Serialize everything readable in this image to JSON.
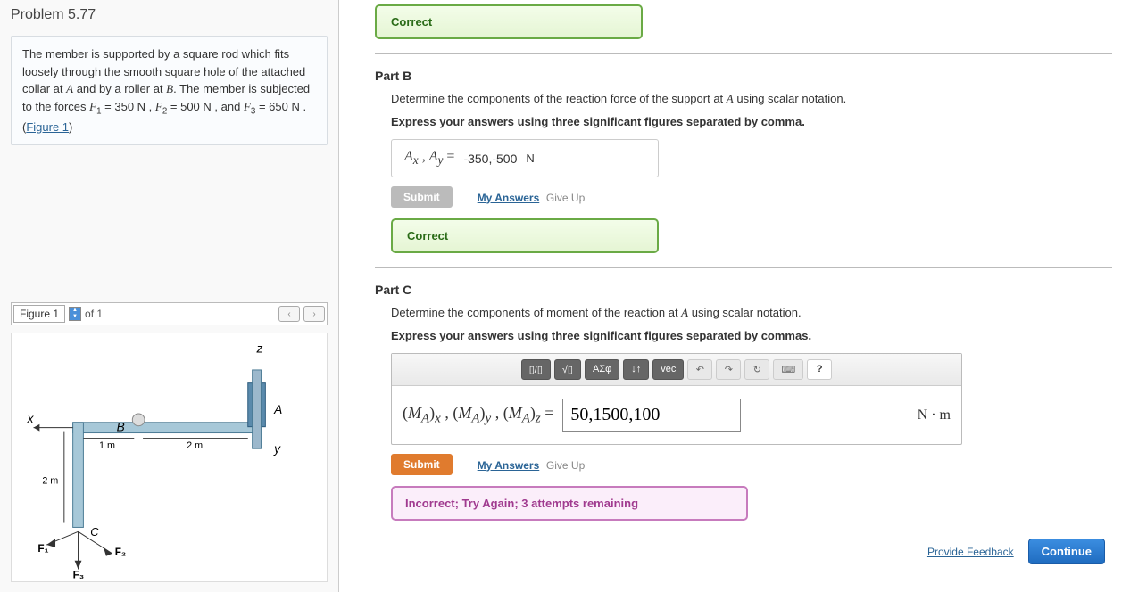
{
  "problem": {
    "title": "Problem 5.77",
    "text_pre": "The member is supported by a square rod which fits loosely through the smooth square hole of the attached collar at ",
    "A": "A",
    "text_mid1": " and by a roller at ",
    "B": "B",
    "text_mid2": ". The member is subjected to the forces ",
    "F1_lhs": "F",
    "F1_sub": "1",
    "F1_eq": " = 350  N , ",
    "F2_lhs": "F",
    "F2_sub": "2",
    "F2_eq": " = 500  N , and ",
    "F3_lhs": "F",
    "F3_sub": "3",
    "F3_eq": " = 650  N . (",
    "figure_link": "Figure 1",
    "text_end": ")"
  },
  "figure": {
    "label": "Figure 1",
    "count_of": "of 1",
    "prev": "‹",
    "next": "›",
    "axis_z": "z",
    "axis_x": "x",
    "axis_y": "y",
    "ptA": "A",
    "ptB": "B",
    "ptC": "C",
    "d1": "1 m",
    "d2a": "2 m",
    "d2b": "2 m",
    "F1": "F₁",
    "F2": "F₂",
    "F3": "F₃"
  },
  "partTop": {
    "correct": "Correct"
  },
  "partB": {
    "heading": "Part B",
    "instruction_pre": "Determine the components of the reaction force of the support at ",
    "instruction_A": "A",
    "instruction_post": " using scalar notation.",
    "bold_instruction": "Express your answers using three significant figures separated by comma.",
    "lhs": "Aₓ , A_y  =",
    "value": "-350,-500",
    "unit": "N",
    "submit": "Submit",
    "my_answers": "My Answers",
    "give_up": "Give Up",
    "correct": "Correct"
  },
  "partC": {
    "heading": "Part C",
    "instruction_pre": "Determine the components of moment of the reaction at ",
    "instruction_A": "A",
    "instruction_post": " using scalar notation.",
    "bold_instruction": "Express your answers using three significant figures separated by commas.",
    "lhs": "(M_A)ₓ , (M_A)_y , (M_A)_z  =",
    "value": "50,1500,100",
    "unit": "N · m",
    "submit": "Submit",
    "my_answers": "My Answers",
    "give_up": "Give Up",
    "toolbar": {
      "frac": "▯/▯",
      "sqrt": "√▯",
      "greek": "ΑΣφ",
      "updown": "↓↑",
      "vec": "vec",
      "undo": "↶",
      "redo": "↷",
      "reset": "↻",
      "keyboard": "⌨",
      "help": "?"
    },
    "incorrect": "Incorrect; Try Again; 3 attempts remaining"
  },
  "footer": {
    "feedback": "Provide Feedback",
    "continue": "Continue"
  }
}
